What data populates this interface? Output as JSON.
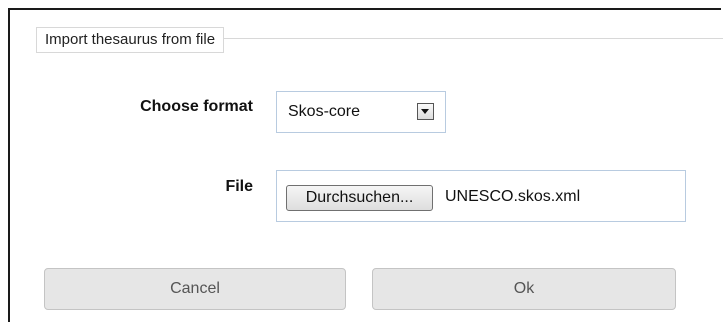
{
  "dialog": {
    "title": "Import thesaurus from file"
  },
  "format": {
    "label": "Choose format",
    "selected": "Skos-core"
  },
  "file": {
    "label": "File",
    "browse_label": "Durchsuchen...",
    "filename": "UNESCO.skos.xml"
  },
  "actions": {
    "cancel_label": "Cancel",
    "ok_label": "Ok"
  },
  "colors": {
    "button_bg": "#e6e6e6",
    "button_text": "#555555",
    "field_border": "#b8cbe0"
  },
  "icons": {
    "select_toggle": "chevron-down-icon"
  }
}
